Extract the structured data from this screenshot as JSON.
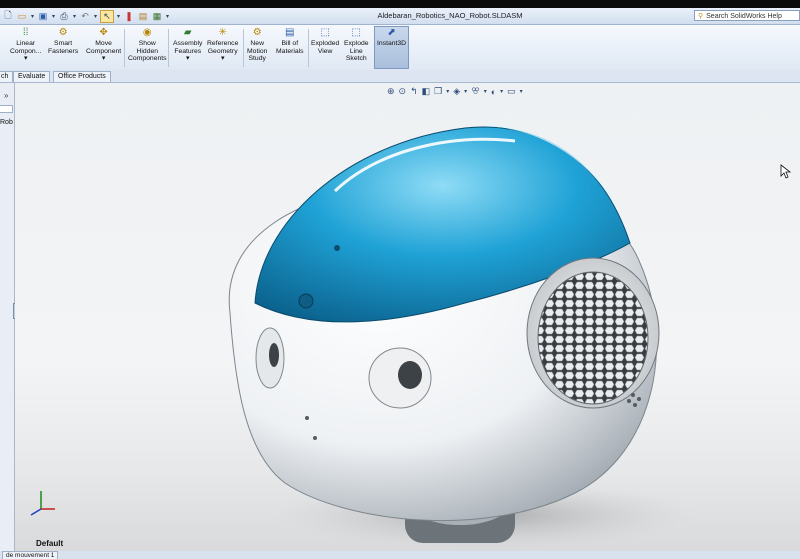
{
  "window": {
    "title": "Aldebaran_Robotics_NAO_Robot.SLDASM"
  },
  "search": {
    "placeholder": "Search SolidWorks Help",
    "icon": "search-icon"
  },
  "quick_access": [
    "new-icon",
    "open-icon",
    "save-icon",
    "print-icon",
    "undo-icon",
    "select-icon",
    "rebuild-icon",
    "options-icon"
  ],
  "ribbon": {
    "items": [
      {
        "label": "Linear\nCompon...",
        "arrow": "▾",
        "icon": "linear-pattern-icon"
      },
      {
        "label": "Smart\nFasteners",
        "icon": "smart-fasteners-icon"
      },
      {
        "label": "Move\nComponent",
        "arrow": "▾",
        "icon": "move-component-icon"
      },
      {
        "label": "Show\nHidden\nComponents",
        "icon": "show-hidden-icon"
      },
      {
        "label": "Assembly\nFeatures",
        "arrow": "▾",
        "icon": "assembly-features-icon"
      },
      {
        "label": "Reference\nGeometry",
        "arrow": "▾",
        "icon": "reference-geometry-icon"
      },
      {
        "label": "New\nMotion\nStudy",
        "icon": "motion-study-icon"
      },
      {
        "label": "Bill of\nMaterials",
        "icon": "bom-icon"
      },
      {
        "label": "Exploded\nView",
        "icon": "exploded-view-icon"
      },
      {
        "label": "Explode\nLine\nSketch",
        "icon": "explode-line-icon"
      },
      {
        "label": "Instant3D",
        "icon": "instant3d-icon",
        "selected": true
      }
    ]
  },
  "tabs": [
    "ch",
    "Evaluate",
    "Office Products"
  ],
  "left_panel": {
    "collapse_glyph": "»",
    "tree_text": "Rob"
  },
  "viewport": {
    "hud_icons": [
      "zoom-to-fit-icon",
      "zoom-area-icon",
      "previous-view-icon",
      "section-view-icon",
      "view-orientation-icon",
      "display-style-icon",
      "hide-show-icon",
      "appearance-icon",
      "scene-icon"
    ],
    "config_label": "Default",
    "colors": {
      "shell_white": "#f4f6f8",
      "shell_blue": "#1a8fc4"
    }
  },
  "status": {
    "motion_tab": "de mouvement 1"
  }
}
